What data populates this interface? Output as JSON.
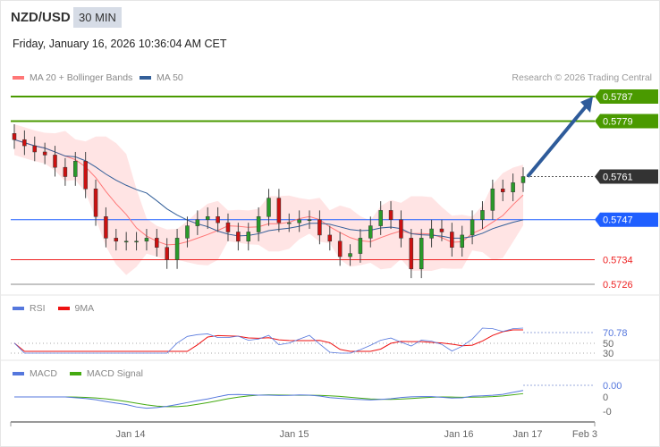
{
  "header": {
    "symbol": "NZD/USD",
    "timeframe": "30 MIN",
    "datetime": "Friday, January 16, 2026 10:36:04 AM CET"
  },
  "legend": {
    "ma20": "MA 20 + Bollinger Bands",
    "ma50": "MA 50",
    "credit": "Research © 2026 Trading Central"
  },
  "colors": {
    "green": "#4a9a00",
    "blue": "#1f5fff",
    "red": "#ee2222",
    "dark": "#333333",
    "ma20": "#ff7777",
    "ma50": "#335f99",
    "band": "#ffdddd",
    "arrow": "#2e5b9a"
  },
  "chart_data": {
    "type": "candlestick",
    "levels": [
      {
        "label": "0.5787",
        "value": 0.5787,
        "kind": "resistance"
      },
      {
        "label": "0.5779",
        "value": 0.5779,
        "kind": "resistance"
      },
      {
        "label": "0.5761",
        "value": 0.5761,
        "kind": "current"
      },
      {
        "label": "0.5747",
        "value": 0.5747,
        "kind": "pivot"
      },
      {
        "label": "0.5734",
        "value": 0.5734,
        "kind": "support"
      },
      {
        "label": "0.5726",
        "value": 0.5726,
        "kind": "support"
      }
    ],
    "closes": [
      0.5773,
      0.5771,
      0.5769,
      0.5768,
      0.5764,
      0.5761,
      0.5766,
      0.5757,
      0.5748,
      0.5741,
      0.574,
      0.574,
      0.574,
      0.5741,
      0.5738,
      0.5734,
      0.5741,
      0.5745,
      0.5747,
      0.5748,
      0.5746,
      0.5743,
      0.574,
      0.5743,
      0.5748,
      0.5754,
      0.5746,
      0.5746,
      0.5747,
      0.5747,
      0.5742,
      0.574,
      0.5735,
      0.5736,
      0.5741,
      0.5745,
      0.575,
      0.5747,
      0.5741,
      0.5731,
      0.5741,
      0.5744,
      0.5743,
      0.5738,
      0.5742,
      0.5747,
      0.575,
      0.5757,
      0.5756,
      0.5759,
      0.5761
    ],
    "x_ticks": [
      "Jan 14",
      "Jan 15",
      "Jan 16",
      "Jan 17",
      "Feb 3"
    ],
    "rsi": {
      "title": "RSI",
      "signal": "9MA",
      "value_label": "70.78",
      "levels": [
        "50",
        "30"
      ]
    },
    "macd": {
      "title": "MACD",
      "signal": "MACD Signal",
      "value_label": "0.00",
      "levels": [
        "0",
        "-0"
      ]
    },
    "forecast": {
      "target": 0.5787
    }
  }
}
